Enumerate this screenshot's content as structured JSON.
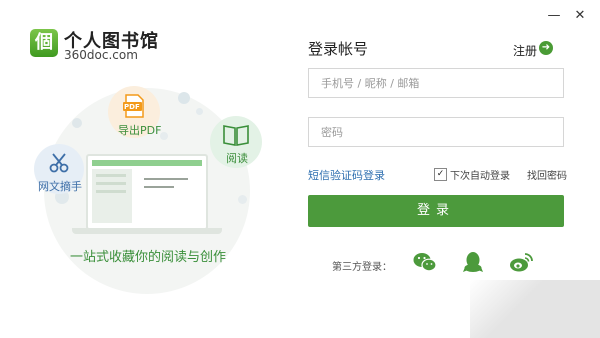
{
  "window": {
    "minimize_glyph": "—",
    "close_glyph": "✕"
  },
  "brand": {
    "badge_char": "個",
    "name": "个人图书馆",
    "domain": "360doc.com"
  },
  "illustration": {
    "features": [
      {
        "label": "导出PDF",
        "icon": "pdf-icon",
        "badge": "PDF"
      },
      {
        "label": "阅读",
        "icon": "book-icon"
      },
      {
        "label": "网文摘手",
        "icon": "scissors-icon"
      }
    ],
    "slogan": "一站式收藏你的阅读与创作",
    "colors": {
      "accent": "#4c9a3c",
      "orange": "#f39a1a"
    }
  },
  "login": {
    "title": "登录帐号",
    "register_label": "注册",
    "account_placeholder": "手机号 / 昵称 / 邮箱",
    "password_placeholder": "密码",
    "sms_login_label": "短信验证码登录",
    "auto_login_label": "下次自动登录",
    "auto_login_checked": true,
    "forgot_label": "找回密码",
    "submit_label": "登录",
    "third_party_label": "第三方登录：",
    "third_party": [
      "wechat-icon",
      "qq-icon",
      "weibo-icon"
    ]
  }
}
